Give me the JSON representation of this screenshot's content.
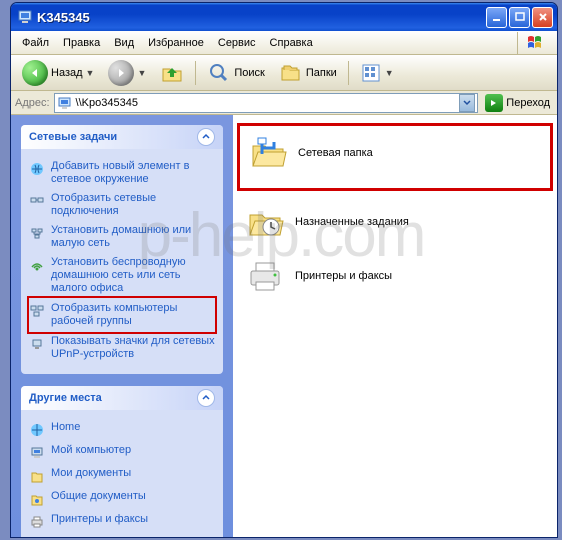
{
  "window": {
    "title": "K345345"
  },
  "menu": {
    "file": "Файл",
    "edit": "Правка",
    "view": "Вид",
    "favorites": "Избранное",
    "tools": "Сервис",
    "help": "Справка"
  },
  "toolbar": {
    "back": "Назад",
    "search": "Поиск",
    "folders": "Папки"
  },
  "address": {
    "label": "Адрес:",
    "value": "\\\\Kpo345345",
    "go": "Переход"
  },
  "sidebar": {
    "tasks_title": "Сетевые задачи",
    "tasks": [
      "Добавить новый элемент в сетевое окружение",
      "Отобразить сетевые подключения",
      "Установить домашнюю или малую сеть",
      "Установить беспроводную домашнюю сеть или сеть малого офиса",
      "Отобразить компьютеры рабочей группы",
      "Показывать значки для сетевых UPnP-устройств"
    ],
    "places_title": "Другие места",
    "places": [
      "Home",
      "Мой компьютер",
      "Мои документы",
      "Общие документы",
      "Принтеры и факсы"
    ]
  },
  "items": [
    "Сетевая папка",
    "Назначенные задания",
    "Принтеры и факсы"
  ],
  "watermark": "p-help.com"
}
